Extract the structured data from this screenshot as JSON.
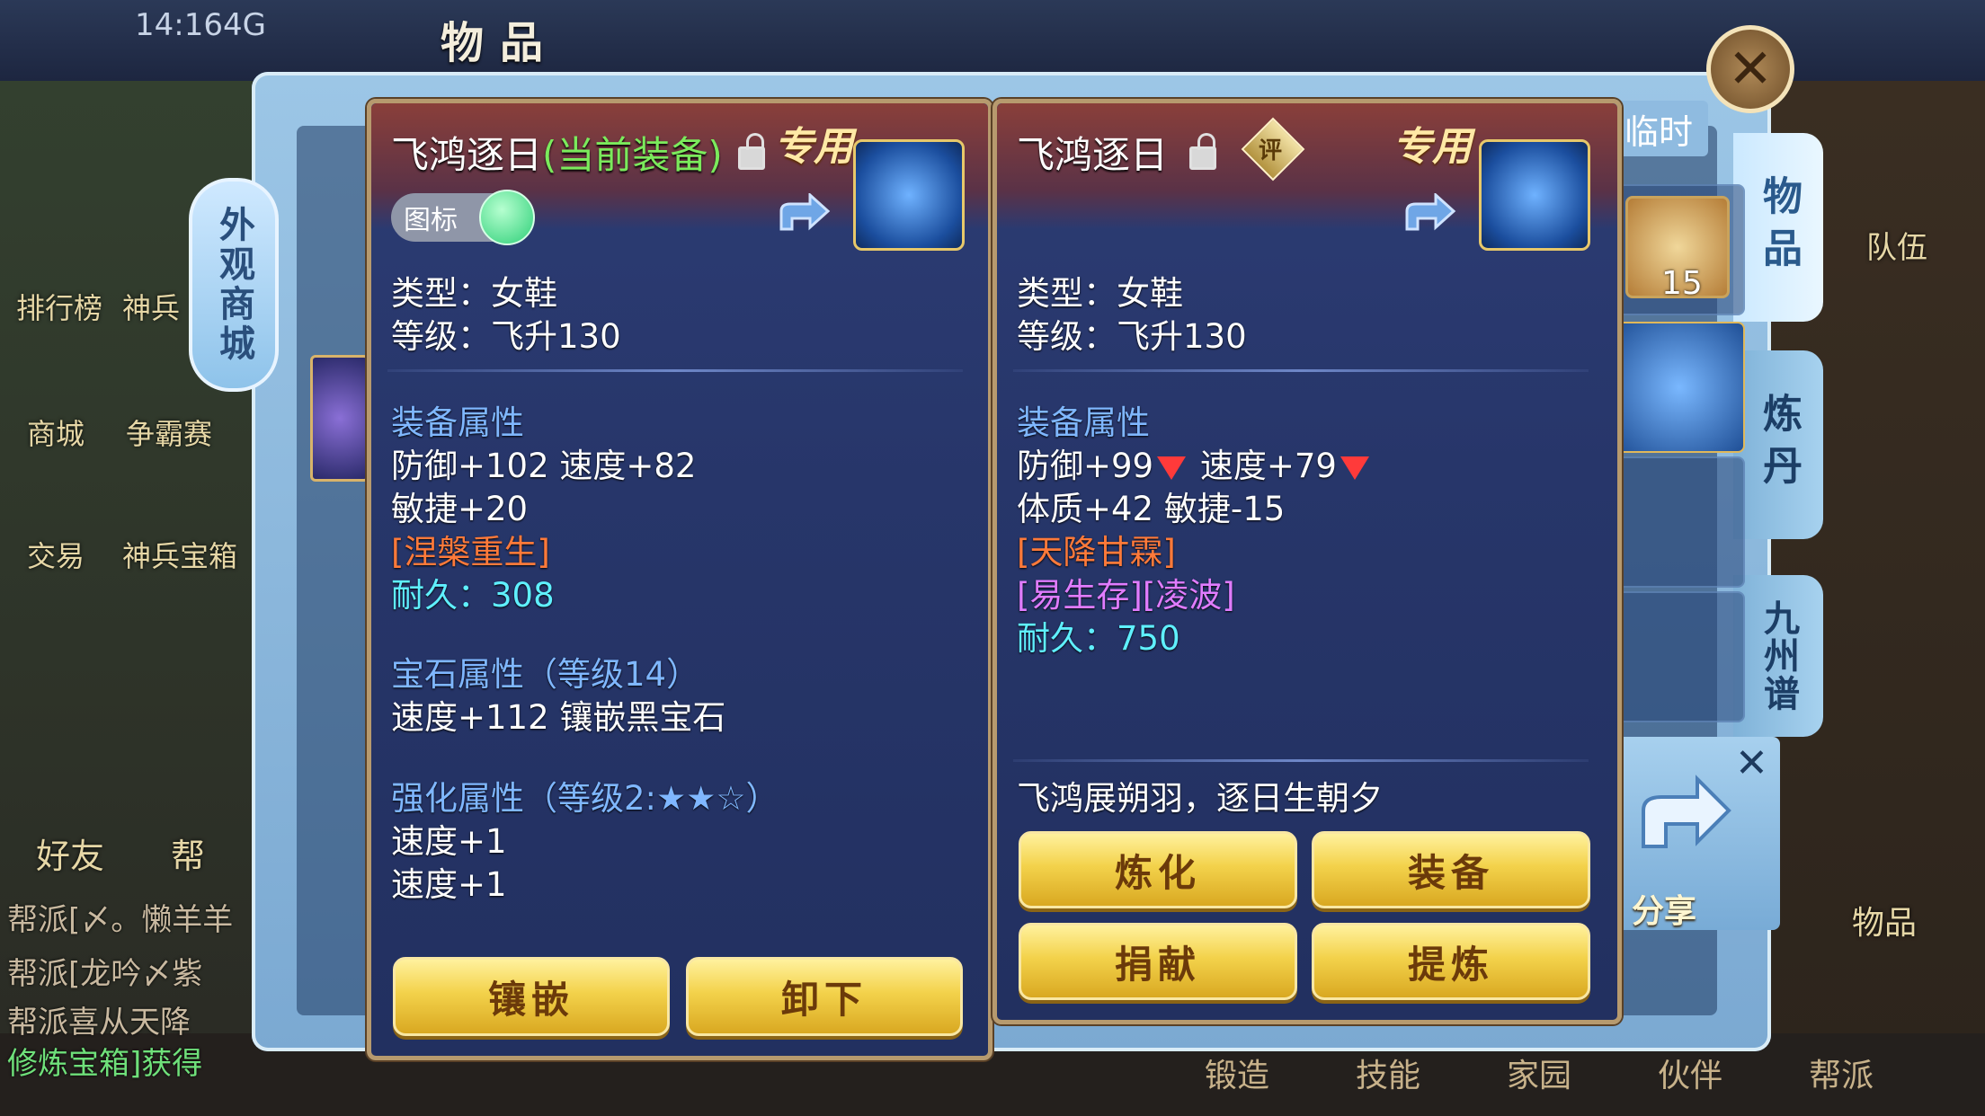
{
  "status_bar": {
    "time": "14:16",
    "network": "4G"
  },
  "panel": {
    "title": "物品",
    "temp_tab": "临时"
  },
  "side_tabs": [
    "物品",
    "炼丹",
    "九州谱"
  ],
  "left_menu": [
    "排行榜",
    "神兵",
    "商城",
    "争霸赛",
    "交易",
    "神兵宝箱",
    "好友",
    "帮"
  ],
  "mall_tag": "外观商城",
  "inventory": {
    "stack_count": "15"
  },
  "share": {
    "label": "分享"
  },
  "chat_lines": [
    "帮派[〆。懒羊羊",
    "帮派[龙吟〆紫",
    "帮派喜从天降",
    "修炼宝箱]获得"
  ],
  "bottom_nav": [
    "锻造",
    "技能",
    "家园",
    "伙伴",
    "帮派"
  ],
  "right_side": {
    "team": "队伍",
    "items": "物品"
  },
  "equipped": {
    "name": "飞鸿逐日",
    "current_tag": "(当前装备)",
    "exclusive": "专用",
    "icon_toggle_label": "图标",
    "type_line": "类型：女鞋",
    "level_line": "等级：飞升130",
    "section_attr": "装备属性",
    "attr_line1": "防御+102 速度+82",
    "attr_line2": "敏捷+20",
    "special": "[涅槃重生]",
    "durability": "耐久：308",
    "gem_title": "宝石属性（等级14）",
    "gem_line": "速度+112 镶嵌黑宝石",
    "enhance_title": "强化属性（等级2:★★☆）",
    "enhance_line1": "速度+1",
    "enhance_line2": "速度+1",
    "buttons": {
      "inlay": "镶嵌",
      "unequip": "卸下"
    }
  },
  "compare": {
    "name": "飞鸿逐日",
    "rating_badge": "评",
    "exclusive": "专用",
    "type_line": "类型：女鞋",
    "level_line": "等级：飞升130",
    "section_attr": "装备属性",
    "attr_def": "防御+99",
    "attr_spd": "速度+79",
    "attr_line2": "体质+42 敏捷-15",
    "special": "[天降甘霖]",
    "special2": "[易生存][凌波]",
    "durability": "耐久：750",
    "flavor": "飞鸿展朔羽，逐日生朝夕",
    "buttons": {
      "refine": "炼化",
      "equip": "装备",
      "donate": "捐献",
      "extract": "提炼"
    }
  }
}
